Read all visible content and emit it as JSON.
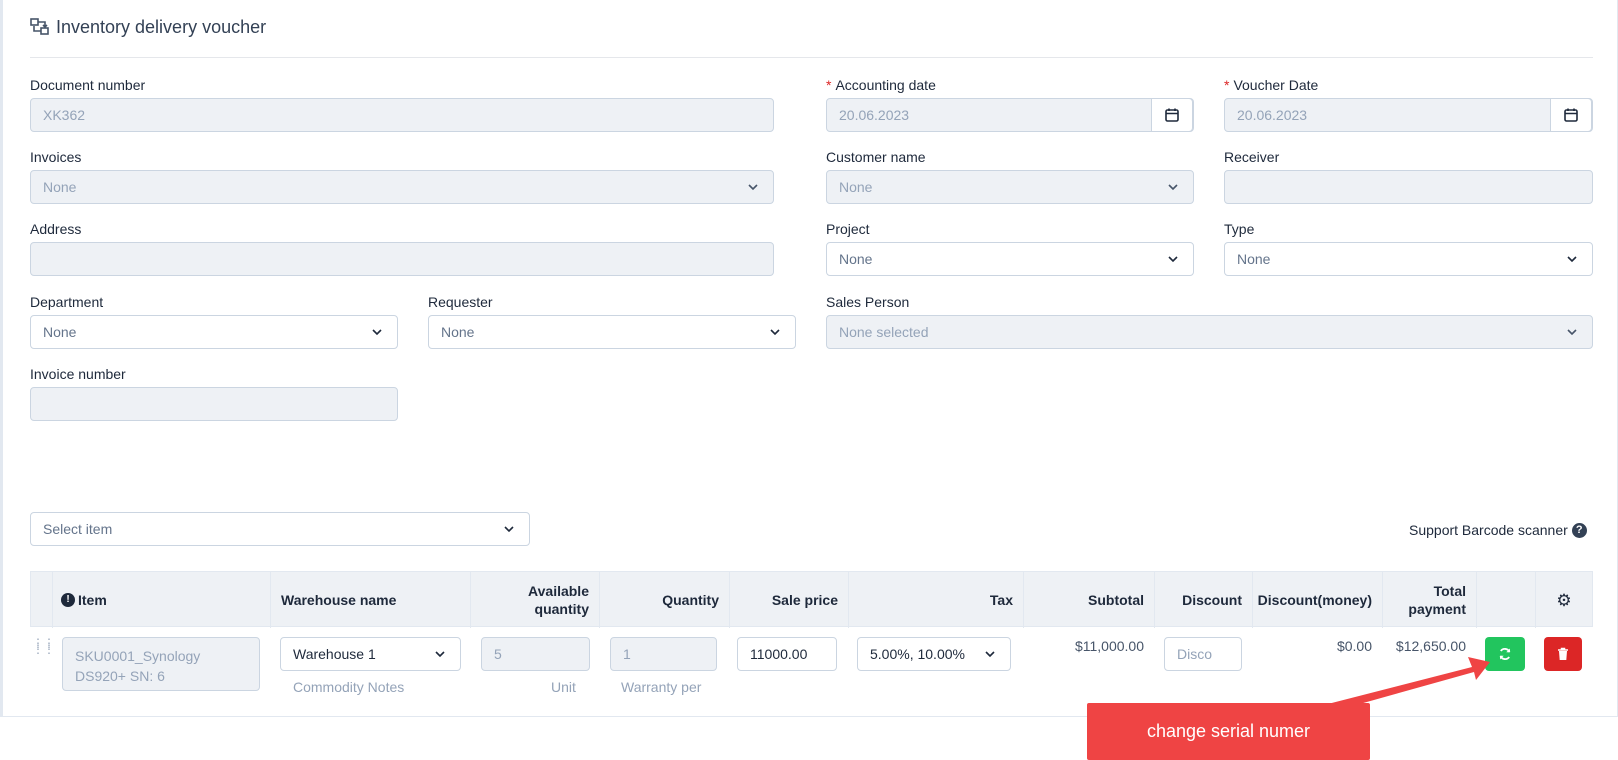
{
  "header": {
    "title": "Inventory delivery voucher",
    "icon": "transfer-icon"
  },
  "form": {
    "document_number": {
      "label": "Document number",
      "value": "XK362"
    },
    "accounting_date": {
      "required": "*",
      "label": "Accounting date",
      "value": "20.06.2023"
    },
    "voucher_date": {
      "required": "*",
      "label": "Voucher Date",
      "value": "20.06.2023"
    },
    "invoices": {
      "label": "Invoices",
      "value": "None"
    },
    "customer_name": {
      "label": "Customer name",
      "value": "None"
    },
    "receiver": {
      "label": "Receiver",
      "value": ""
    },
    "address": {
      "label": "Address",
      "value": ""
    },
    "project": {
      "label": "Project",
      "value": "None"
    },
    "type": {
      "label": "Type",
      "value": "None"
    },
    "department": {
      "label": "Department",
      "value": "None"
    },
    "requester": {
      "label": "Requester",
      "value": "None"
    },
    "sales_person": {
      "label": "Sales Person",
      "value": "None selected"
    },
    "invoice_number": {
      "label": "Invoice number",
      "value": ""
    }
  },
  "item_select": {
    "placeholder": "Select item"
  },
  "barcode": {
    "label": "Support Barcode scanner"
  },
  "table": {
    "headers": {
      "item": "Item",
      "warehouse": "Warehouse name",
      "available_quantity": "Available quantity",
      "quantity": "Quantity",
      "sale_price": "Sale price",
      "tax": "Tax",
      "subtotal": "Subtotal",
      "discount": "Discount",
      "discount_money": "Discount(money)",
      "total_payment": "Total payment"
    },
    "row": {
      "item": "SKU0001_Synology DS920+ SN: 6",
      "warehouse": "Warehouse 1",
      "commodity_notes": "Commodity Notes",
      "available_quantity": "5",
      "unit": "Unit",
      "quantity": "1",
      "warranty": "Warranty per",
      "sale_price": "11000.00",
      "tax": "5.00%, 10.00%",
      "subtotal": "$11,000.00",
      "discount_placeholder": "Disco",
      "discount_money": "$0.00",
      "total_payment": "$12,650.00"
    }
  },
  "callout": {
    "text": "change serial numer"
  },
  "colors": {
    "green": "#22c55e",
    "red": "#dc2626",
    "callout": "#ef4444"
  }
}
